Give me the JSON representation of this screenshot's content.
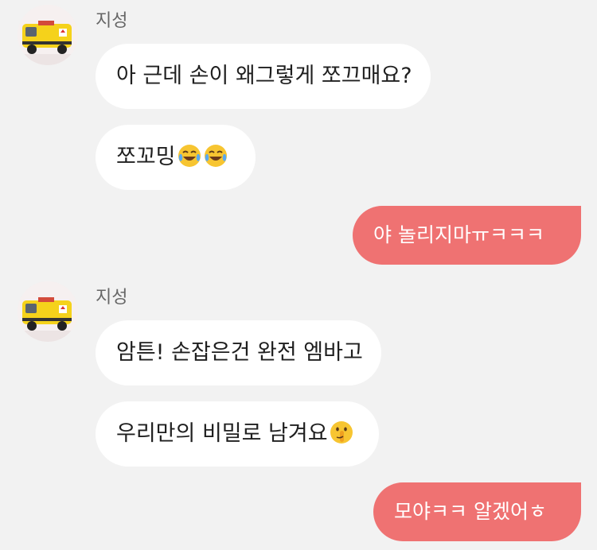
{
  "colors": {
    "background": "#f2f2f2",
    "my_bubble": "#ef7272",
    "their_bubble": "#ffffff",
    "sender_name": "#666666"
  },
  "messages": [
    {
      "sender": "지성",
      "text": "아 근데 손이 왜그렇게 쪼끄매요?"
    },
    {
      "text": "쪼꼬밍",
      "emoji": [
        "face-with-tears-of-joy-icon",
        "face-with-tears-of-joy-icon"
      ]
    },
    {
      "mine": true,
      "text": "야 놀리지마ㅠㅋㅋㅋ"
    },
    {
      "sender": "지성",
      "text": "암튼! 손잡은건 완전 엠바고"
    },
    {
      "text": "우리만의 비밀로 남겨요",
      "emoji": [
        "shushing-face-icon"
      ]
    },
    {
      "mine": true,
      "text": "모야ㅋㅋ 알겠어ㅎ"
    }
  ]
}
